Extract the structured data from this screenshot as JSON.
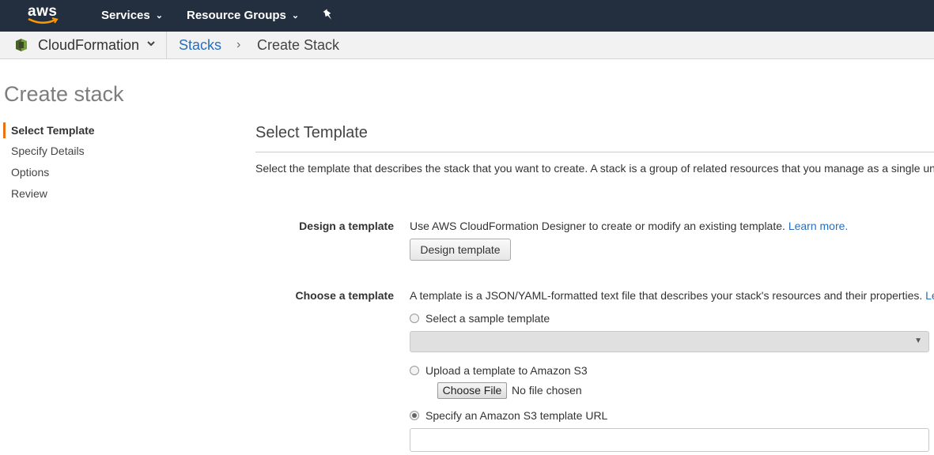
{
  "topnav": {
    "logo_text": "aws",
    "services_label": "Services",
    "resource_groups_label": "Resource Groups"
  },
  "subnav": {
    "service_name": "CloudFormation",
    "crumb_link": "Stacks",
    "crumb_separator": "›",
    "crumb_current": "Create Stack"
  },
  "page": {
    "title": "Create stack"
  },
  "steps": [
    {
      "label": "Select Template"
    },
    {
      "label": "Specify Details"
    },
    {
      "label": "Options"
    },
    {
      "label": "Review"
    }
  ],
  "main": {
    "section_title": "Select Template",
    "intro": "Select the template that describes the stack that you want to create. A stack is a group of related resources that you manage as a single unit.",
    "design": {
      "label": "Design a template",
      "text": "Use AWS CloudFormation Designer to create or modify an existing template.",
      "link": "Learn more.",
      "button": "Design template"
    },
    "choose": {
      "label": "Choose a template",
      "text": "A template is a JSON/YAML-formatted text file that describes your stack's resources and their properties.",
      "link": "Lear",
      "option_sample": "Select a sample template",
      "sample_select_value": "",
      "option_upload": "Upload a template to Amazon S3",
      "file_button": "Choose File",
      "file_status": "No file chosen",
      "option_url": "Specify an Amazon S3 template URL",
      "url_value": ""
    }
  },
  "colors": {
    "nav_bg": "#232f3e",
    "accent": "#ec7211",
    "link": "#2a6ebb"
  }
}
